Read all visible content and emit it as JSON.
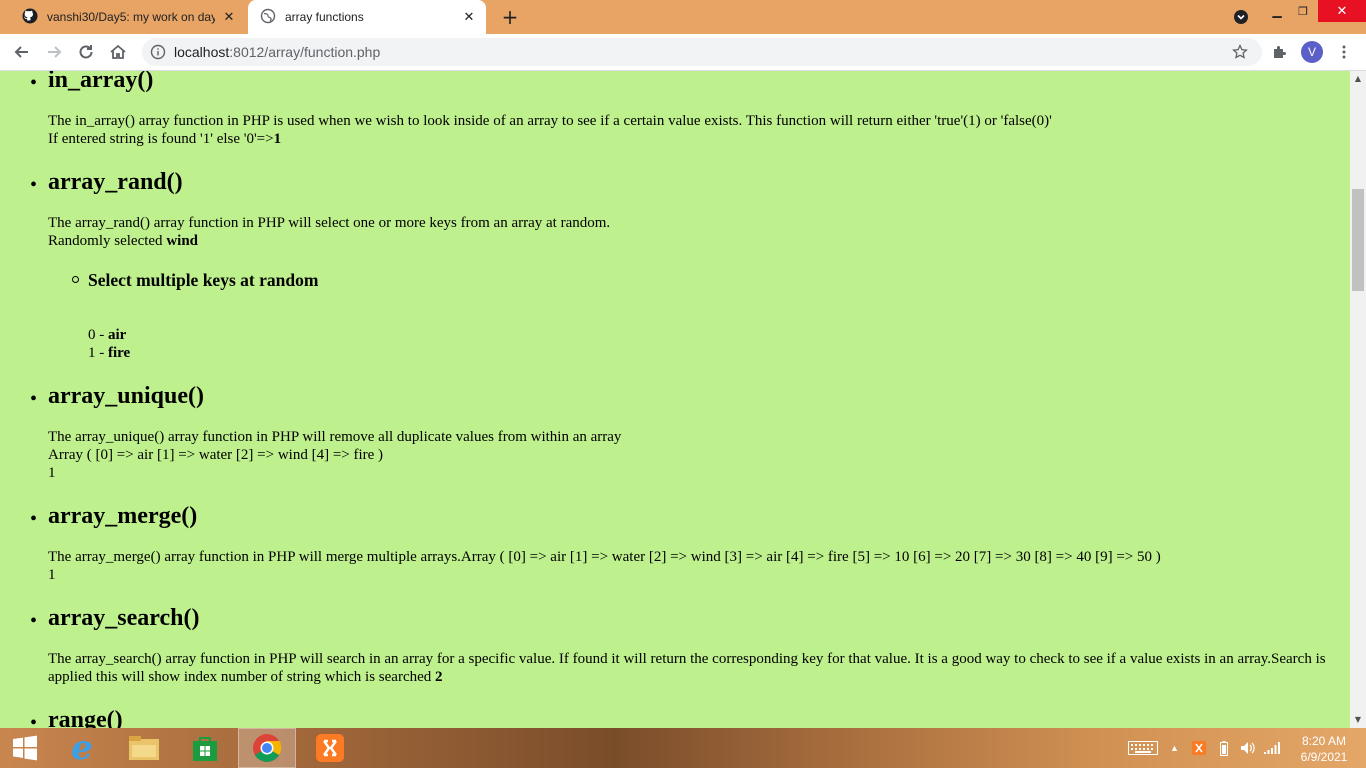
{
  "browser": {
    "tabs": [
      {
        "title": "vanshi30/Day5: my work on day",
        "icon": "github-icon",
        "active": false
      },
      {
        "title": "array functions",
        "icon": "globe-icon",
        "active": true
      }
    ],
    "url_host": "localhost",
    "url_path": ":8012/array/function.php",
    "profile_initial": "V"
  },
  "page": {
    "in_array": {
      "heading": "in_array()",
      "desc": "The in_array() array function in PHP is used when we wish to look inside of an array to see if a certain value exists. This function will return either 'true'(1) or 'false(0)'",
      "result_prefix": "If entered string is found '1' else '0'=>",
      "result_value": "1"
    },
    "array_rand": {
      "heading": "array_rand()",
      "desc": "The array_rand() array function in PHP will select one or more keys from an array at random.",
      "result_prefix": "Randomly selected",
      "result_value": "wind",
      "sub_heading": "Select multiple keys at random",
      "keys": [
        {
          "index": "0 - ",
          "value": "air"
        },
        {
          "index": "1 - ",
          "value": "fire"
        }
      ]
    },
    "array_unique": {
      "heading": "array_unique()",
      "desc": "The array_unique() array function in PHP will remove all duplicate values from within an array",
      "output": "Array ( [0] => air [1] => water [2] => wind [4] => fire )",
      "ret": "1"
    },
    "array_merge": {
      "heading": "array_merge()",
      "desc": "The array_merge() array function in PHP will merge multiple arrays.Array ( [0] => air [1] => water [2] => wind [3] => air [4] => fire [5] => 10 [6] => 20 [7] => 30 [8] => 40 [9] => 50 )",
      "ret": "1"
    },
    "array_search": {
      "heading": "array_search()",
      "desc": "The array_search() array function in PHP will search in an array for a specific value. If found it will return the corresponding key for that value. It is a good way to check to see if a value exists in an array.Search is applied this will show index number of string which is searched",
      "result_value": "2"
    },
    "range": {
      "heading": "range()"
    }
  },
  "taskbar": {
    "time": "8:20 AM",
    "date": "6/9/2021"
  },
  "colors": {
    "page_background": "#bff08e",
    "tabbar": "#e8a465"
  }
}
